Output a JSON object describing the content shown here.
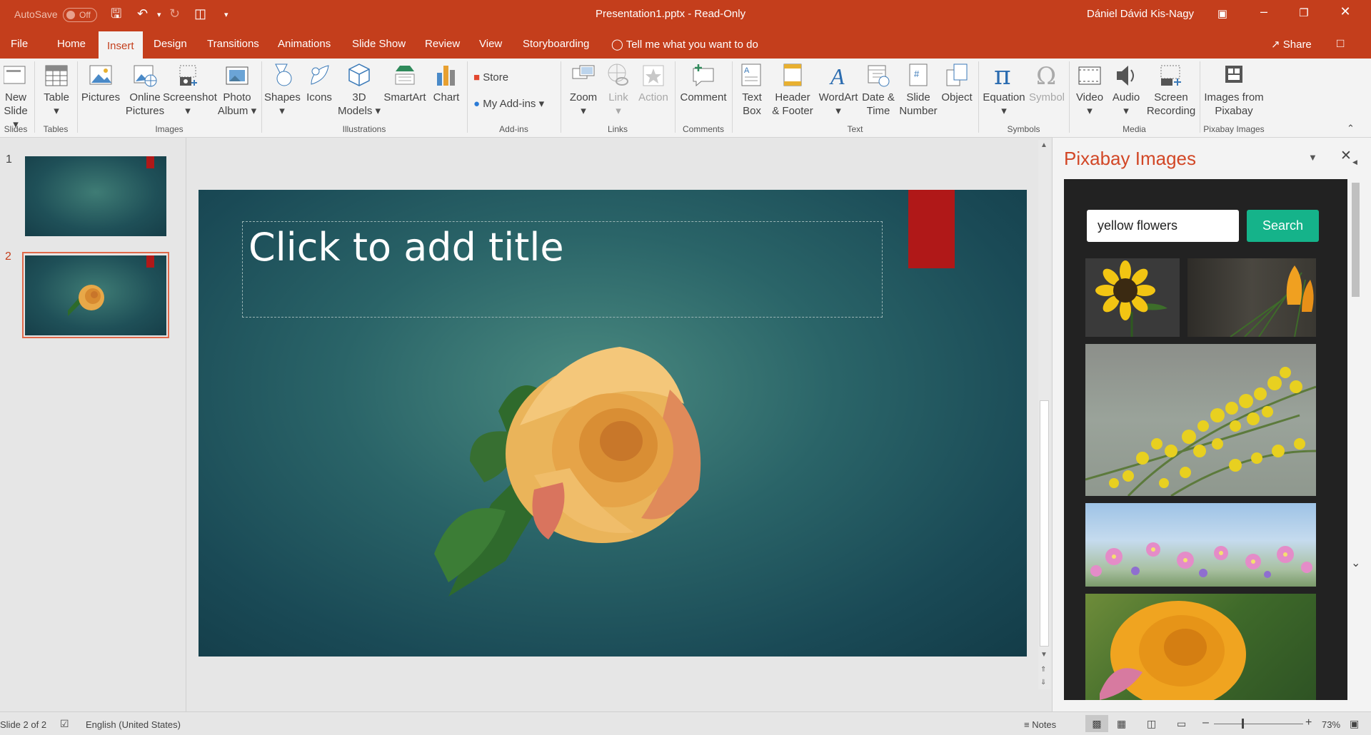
{
  "titlebar": {
    "autosave": "AutoSave",
    "autosave_state": "Off",
    "doc_title": "Presentation1.pptx  -  Read-Only",
    "user": "Dániel Dávid Kis-Nagy"
  },
  "tabs": [
    "File",
    "Home",
    "Insert",
    "Design",
    "Transitions",
    "Animations",
    "Slide Show",
    "Review",
    "View",
    "Storyboarding"
  ],
  "tell_me": "Tell me what you want to do",
  "share": "Share",
  "ribbon": {
    "new_slide": [
      "New",
      "Slide"
    ],
    "table": "Table",
    "pictures": "Pictures",
    "online_pictures": [
      "Online",
      "Pictures"
    ],
    "screenshot": "Screenshot",
    "photo_album": [
      "Photo",
      "Album"
    ],
    "shapes": "Shapes",
    "icons": "Icons",
    "models_3d": [
      "3D",
      "Models"
    ],
    "smartart": "SmartArt",
    "chart": "Chart",
    "store": "Store",
    "my_addins": "My Add-ins",
    "zoom": "Zoom",
    "link": "Link",
    "action": "Action",
    "comment": "Comment",
    "text_box": [
      "Text",
      "Box"
    ],
    "header_footer": [
      "Header",
      "& Footer"
    ],
    "wordart": "WordArt",
    "date_time": [
      "Date &",
      "Time"
    ],
    "slide_number": [
      "Slide",
      "Number"
    ],
    "object": "Object",
    "equation": "Equation",
    "symbol": "Symbol",
    "video": "Video",
    "audio": "Audio",
    "screen_recording": [
      "Screen",
      "Recording"
    ],
    "images_pixabay": [
      "Images from",
      "Pixabay"
    ],
    "groups": {
      "slides": "Slides",
      "tables": "Tables",
      "images": "Images",
      "illustrations": "Illustrations",
      "addins": "Add-ins",
      "links": "Links",
      "comments": "Comments",
      "text": "Text",
      "symbols": "Symbols",
      "media": "Media",
      "pixabay": "Pixabay Images"
    }
  },
  "thumbs": {
    "n1": "1",
    "n2": "2"
  },
  "slide": {
    "title_placeholder": "Click to add title"
  },
  "pane": {
    "title": "Pixabay Images",
    "search_value": "yellow flowers",
    "search_button": "Search"
  },
  "status": {
    "slide": "Slide 2 of 2",
    "language": "English (United States)",
    "notes": "Notes",
    "zoom": "73%"
  },
  "colors": {
    "accent": "#c43e1c",
    "pane_title": "#d24726",
    "search_button": "#15b38a"
  }
}
